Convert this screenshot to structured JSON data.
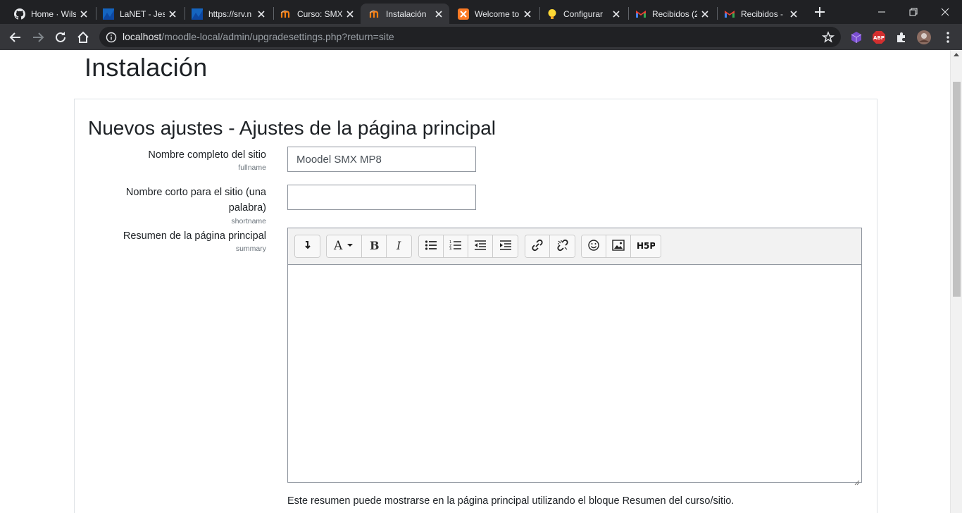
{
  "browser": {
    "tabs": [
      {
        "title": "Home · Wils",
        "icon": "github-icon"
      },
      {
        "title": "LaNET - Jes",
        "icon": "lanet-icon"
      },
      {
        "title": "https://srv.n",
        "icon": "lanet-icon"
      },
      {
        "title": "Curso: SMX",
        "icon": "moodle-icon"
      },
      {
        "title": "Instalación",
        "icon": "moodle-icon"
      },
      {
        "title": "Welcome to",
        "icon": "xampp-icon"
      },
      {
        "title": "Configurar",
        "icon": "bulb-icon"
      },
      {
        "title": "Recibidos (2",
        "icon": "gmail-icon"
      },
      {
        "title": "Recibidos -",
        "icon": "gmail-icon"
      }
    ],
    "active_tab": 4,
    "url_host": "localhost",
    "url_path": "/moodle-local/admin/upgradesettings.php?return=site",
    "ext_abp": "ABP"
  },
  "page": {
    "title": "Instalación",
    "section_title": "Nuevos ajustes - Ajustes de la página principal",
    "fields": {
      "fullname": {
        "label": "Nombre completo del sitio",
        "name": "fullname",
        "value": "Moodel SMX MP8"
      },
      "shortname": {
        "label_line1": "Nombre corto para el sitio (una",
        "label_line2": "palabra)",
        "name": "shortname",
        "value": ""
      },
      "summary": {
        "label": "Resumen de la página principal",
        "name": "summary"
      }
    },
    "editor": {
      "h5p_label": "H5P",
      "buttons": [
        "expand-toolbar",
        "font-style",
        "bold",
        "italic",
        "unordered-list",
        "ordered-list",
        "outdent",
        "indent",
        "link",
        "unlink",
        "emoji",
        "image",
        "h5p"
      ]
    },
    "help_text": "Este resumen puede mostrarse en la página principal utilizando el bloque Resumen del curso/sitio."
  }
}
